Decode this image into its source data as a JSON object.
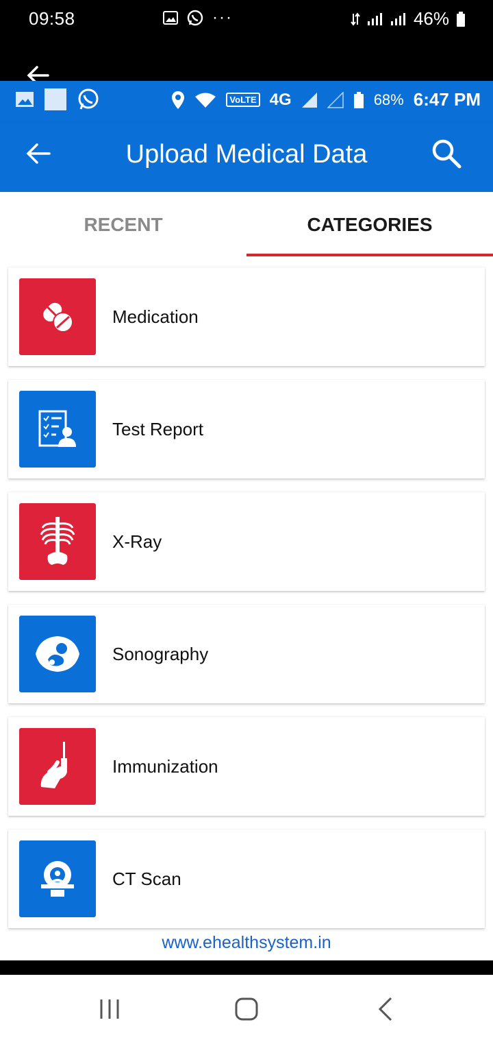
{
  "device_status": {
    "time": "09:58",
    "dots": "···",
    "battery": "46%"
  },
  "inner_status": {
    "volte": "VoLTE",
    "network": "4G",
    "battery": "68%",
    "time": "6:47 PM"
  },
  "toolbar": {
    "title": "Upload Medical Data"
  },
  "tabs": [
    {
      "label": "RECENT"
    },
    {
      "label": "CATEGORIES"
    }
  ],
  "categories": [
    {
      "label": "Medication",
      "color": "#dd2239",
      "icon": "pills-icon"
    },
    {
      "label": "Test Report",
      "color": "#0a6fd6",
      "icon": "test-report-icon"
    },
    {
      "label": "X-Ray",
      "color": "#dd2239",
      "icon": "xray-icon"
    },
    {
      "label": "Sonography",
      "color": "#0a6fd6",
      "icon": "sonography-icon"
    },
    {
      "label": "Immunization",
      "color": "#dd2239",
      "icon": "syringe-icon"
    },
    {
      "label": "CT Scan",
      "color": "#0a6fd6",
      "icon": "ct-scan-icon"
    }
  ],
  "footer": {
    "link": "www.ehealthsystem.in"
  },
  "colors": {
    "primary": "#0a6fd6",
    "accent": "#d8262f"
  }
}
